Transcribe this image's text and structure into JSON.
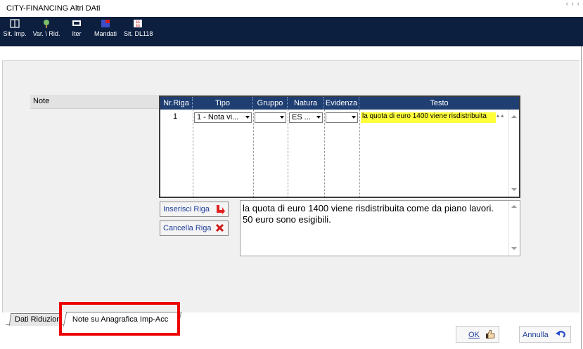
{
  "window": {
    "title": "CITY-FINANCING  Altri DAti",
    "controls_text": "‹ ‹ ‹"
  },
  "toolbar": {
    "buttons": [
      {
        "label": "Sit. Imp.",
        "icon": "book-icon"
      },
      {
        "label": "Var. \\ Rid.",
        "icon": "tree-icon"
      },
      {
        "label": "Iter",
        "icon": "monitor-icon"
      },
      {
        "label": "Mandati",
        "icon": "mandate-icon"
      },
      {
        "label": "Sit. DL118",
        "icon": "dollar-icon"
      }
    ]
  },
  "note_label": "Note",
  "grid": {
    "columns": [
      "Nr.Riga",
      "Tipo",
      "Gruppo",
      "Natura",
      "Evidenza",
      "Testo"
    ],
    "rows": [
      {
        "nr": "1",
        "tipo": "1 - Nota vi...",
        "gruppo": "",
        "natura": "ES ...",
        "evidenza": "",
        "testo": "la quota di euro 1400 viene risdistribuita"
      }
    ],
    "highlight_color": "#ffff3a"
  },
  "buttons": {
    "insert_row": "Inserisci Riga",
    "delete_row": "Cancella Riga",
    "ok": "OK",
    "cancel": "Annulla"
  },
  "memo_text": "la quota di euro 1400 viene risdistribuita come da piano lavori.   50 euro sono  esigibili.",
  "tabs": [
    {
      "label": "Dati Riduzioni",
      "active": false
    },
    {
      "label": "Note su Anagrafica Imp-Acc",
      "active": true
    }
  ],
  "colors": {
    "toolbar_bg": "#0c1f3f",
    "grid_header": "#1f3f73",
    "annotation": "#ee0000"
  }
}
